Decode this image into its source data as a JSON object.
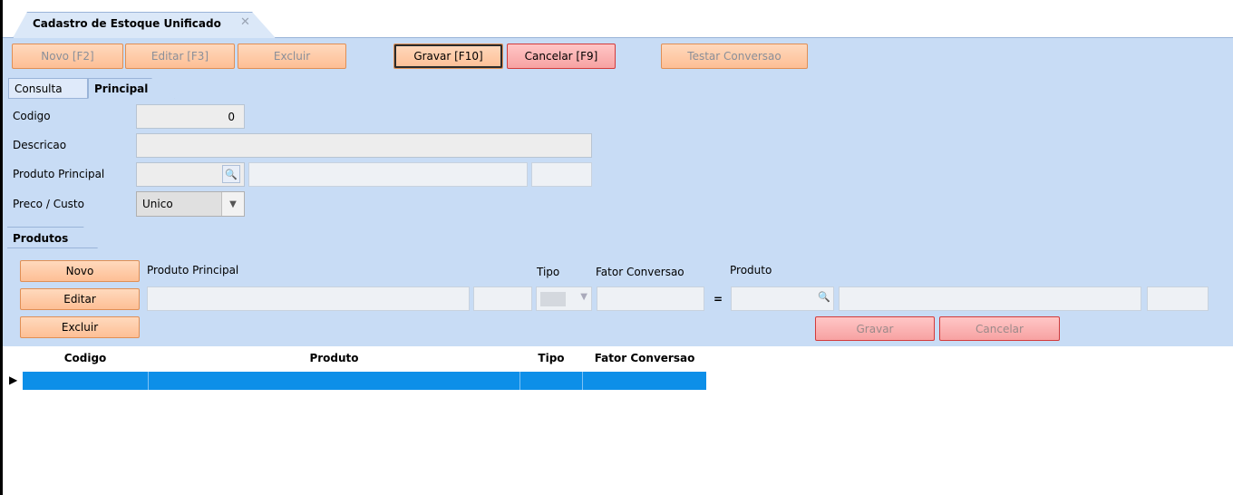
{
  "window": {
    "tab_title": "Cadastro de Estoque Unificado",
    "close_glyph": "✕"
  },
  "toolbar": {
    "novo": "Novo [F2]",
    "editar": "Editar [F3]",
    "excluir": "Excluir",
    "gravar": "Gravar [F10]",
    "cancelar": "Cancelar [F9]",
    "testar": "Testar Conversao"
  },
  "subtabs": {
    "consulta": "Consulta",
    "principal": "Principal"
  },
  "form": {
    "codigo_label": "Codigo",
    "codigo_value": "0",
    "descricao_label": "Descricao",
    "descricao_value": "",
    "produto_principal_label": "Produto Principal",
    "preco_custo_label": "Preco / Custo",
    "preco_custo_value": "Unico"
  },
  "produtos_section": {
    "tab_label": "Produtos",
    "novo_button": "Novo",
    "editar_button": "Editar",
    "excluir_button": "Excluir",
    "col_produto_principal": "Produto Principal",
    "col_tipo": "Tipo",
    "col_fator_conversao": "Fator Conversao",
    "col_produto": "Produto",
    "equals": "=",
    "gravar_button": "Gravar",
    "cancelar_button": "Cancelar"
  },
  "grid": {
    "columns": [
      "Codigo",
      "Produto",
      "Tipo",
      "Fator Conversao"
    ],
    "rows": [
      [
        "",
        "",
        "",
        ""
      ]
    ],
    "row_indicator": "▶",
    "selection_color": "#0d8fe8"
  },
  "icons": {
    "lookup": "magnifier-icon",
    "dropdown": "chevron-down-icon"
  }
}
